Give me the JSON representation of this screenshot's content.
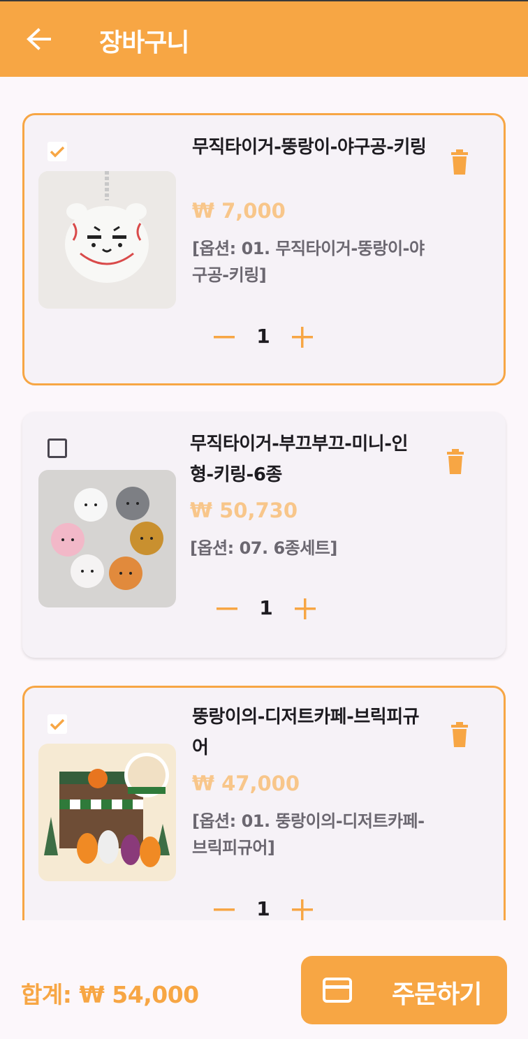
{
  "app_bar": {
    "title": "장바구니",
    "back_icon": "arrow-left-icon"
  },
  "colors": {
    "accent": "#f7a644",
    "price": "#f8c68a",
    "card_bg": "#f6f2f7",
    "page_bg": "#fcf7fb"
  },
  "cart": {
    "items": [
      {
        "checked": true,
        "name": "무직타이거-뚱랑이-야구공-키링",
        "price": "₩ 7,000",
        "option": "[옵션: 01. 무직타이거-뚱랑이-야구공-키링]",
        "quantity": "1"
      },
      {
        "checked": false,
        "name": "무직타이거-부끄부끄-미니-인형-키링-6종",
        "price": "₩ 50,730",
        "option": "[옵션: 07. 6종세트]",
        "quantity": "1"
      },
      {
        "checked": true,
        "name": "뚱랑이의-디저트카페-브릭피규어",
        "price": "₩ 47,000",
        "option": "[옵션: 01. 뚱랑이의-디저트카페-브릭피규어]",
        "quantity": "1"
      }
    ]
  },
  "footer": {
    "total": "합계: ₩ 54,000",
    "order_label": "주문하기",
    "order_icon": "credit-card-icon"
  }
}
